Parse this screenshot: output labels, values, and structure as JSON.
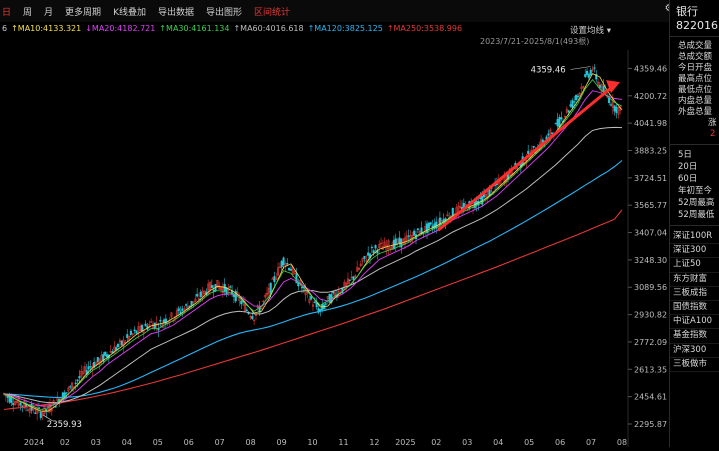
{
  "toolbar": {
    "items": [
      "日",
      "周",
      "月",
      "更多周期",
      "K线叠加",
      "导出数据",
      "导出图形",
      "区间统计"
    ],
    "active_index": 7
  },
  "ma_row": {
    "prefix": "6",
    "items": [
      {
        "label": "↑MA10:4133.321",
        "color": "#f5e04a"
      },
      {
        "label": "↓MA20:4182.721",
        "color": "#e040fb"
      },
      {
        "label": "↑MA30:4161.134",
        "color": "#39d353"
      },
      {
        "label": "↑MA60:4016.618",
        "color": "#bdbdbd"
      },
      {
        "label": "↑MA120:3825.125",
        "color": "#29b6f6"
      },
      {
        "label": "↑MA250:3538.996",
        "color": "#e53935"
      }
    ]
  },
  "settings_label": "设置均线",
  "range_label": "2023/7/21-2025/8/1(493根)",
  "chart_data": {
    "type": "line",
    "title": "",
    "y_ticks": [
      4359.46,
      4200.72,
      4041.98,
      3883.25,
      3724.51,
      3565.77,
      3407.04,
      3248.3,
      3089.56,
      2930.82,
      2772.09,
      2613.35,
      2454.61,
      2295.87
    ],
    "y_tick_labels": [
      "4359.46",
      "4200.72",
      "4041.98",
      "3883.25",
      "3724.51",
      "3565.77",
      "3407.04",
      "3248.30",
      "3089.56",
      "2930.82",
      "2772.09",
      "2613.35",
      "2454.61",
      "2295.87"
    ],
    "ylim": [
      2290,
      4420
    ],
    "x_tick_labels": [
      "2024",
      "02",
      "03",
      "04",
      "05",
      "06",
      "07",
      "08",
      "09",
      "10",
      "11",
      "12",
      "2025",
      "02",
      "03",
      "04",
      "05",
      "06",
      "07",
      "08"
    ],
    "max_label": "4359.46",
    "min_label": "2359.93",
    "price": [
      2470,
      2440,
      2420,
      2400,
      2380,
      2360,
      2380,
      2420,
      2460,
      2500,
      2550,
      2600,
      2640,
      2660,
      2700,
      2730,
      2760,
      2800,
      2830,
      2850,
      2880,
      2870,
      2900,
      2920,
      2950,
      2980,
      3010,
      3050,
      3090,
      3100,
      3080,
      3060,
      3020,
      2960,
      2920,
      2980,
      3060,
      3160,
      3250,
      3200,
      3120,
      3060,
      3000,
      2950,
      3010,
      3050,
      3080,
      3120,
      3180,
      3250,
      3300,
      3320,
      3330,
      3340,
      3350,
      3370,
      3400,
      3420,
      3440,
      3460,
      3490,
      3520,
      3540,
      3560,
      3580,
      3600,
      3640,
      3680,
      3720,
      3760,
      3800,
      3840,
      3880,
      3920,
      3960,
      4020,
      4080,
      4140,
      4200,
      4300,
      4359,
      4260,
      4200,
      4140,
      4100
    ],
    "ma20": [
      2470,
      2460,
      2445,
      2430,
      2415,
      2400,
      2400,
      2410,
      2430,
      2460,
      2490,
      2530,
      2570,
      2600,
      2640,
      2670,
      2700,
      2730,
      2760,
      2790,
      2820,
      2830,
      2850,
      2870,
      2900,
      2930,
      2960,
      2990,
      3020,
      3040,
      3050,
      3050,
      3040,
      3010,
      2980,
      2980,
      3010,
      3060,
      3120,
      3140,
      3120,
      3090,
      3060,
      3020,
      3010,
      3030,
      3050,
      3080,
      3120,
      3170,
      3210,
      3250,
      3270,
      3290,
      3310,
      3330,
      3360,
      3380,
      3400,
      3420,
      3450,
      3480,
      3500,
      3520,
      3540,
      3560,
      3590,
      3620,
      3660,
      3700,
      3740,
      3780,
      3820,
      3860,
      3900,
      3950,
      4000,
      4050,
      4110,
      4180,
      4230,
      4220,
      4200,
      4185,
      4180
    ],
    "ma60": [
      2470,
      2465,
      2455,
      2445,
      2435,
      2425,
      2420,
      2420,
      2425,
      2435,
      2450,
      2470,
      2495,
      2520,
      2550,
      2580,
      2610,
      2640,
      2670,
      2700,
      2730,
      2750,
      2770,
      2790,
      2810,
      2830,
      2850,
      2875,
      2900,
      2920,
      2935,
      2945,
      2950,
      2945,
      2935,
      2935,
      2950,
      2980,
      3020,
      3050,
      3065,
      3070,
      3070,
      3060,
      3060,
      3070,
      3085,
      3100,
      3120,
      3145,
      3170,
      3195,
      3215,
      3235,
      3255,
      3275,
      3300,
      3320,
      3340,
      3360,
      3385,
      3410,
      3430,
      3450,
      3470,
      3490,
      3515,
      3540,
      3570,
      3600,
      3630,
      3660,
      3695,
      3730,
      3765,
      3800,
      3840,
      3880,
      3920,
      3965,
      4000,
      4010,
      4015,
      4017,
      4016
    ],
    "ma120": [
      2470,
      2468,
      2465,
      2462,
      2458,
      2455,
      2452,
      2450,
      2450,
      2452,
      2456,
      2462,
      2470,
      2480,
      2492,
      2505,
      2520,
      2537,
      2555,
      2575,
      2595,
      2615,
      2635,
      2655,
      2675,
      2695,
      2715,
      2735,
      2755,
      2775,
      2792,
      2808,
      2822,
      2833,
      2842,
      2850,
      2860,
      2873,
      2888,
      2903,
      2917,
      2930,
      2941,
      2950,
      2960,
      2970,
      2982,
      2995,
      3010,
      3025,
      3042,
      3060,
      3078,
      3096,
      3114,
      3132,
      3150,
      3170,
      3190,
      3210,
      3230,
      3252,
      3273,
      3294,
      3315,
      3336,
      3357,
      3380,
      3403,
      3427,
      3451,
      3475,
      3500,
      3525,
      3550,
      3576,
      3602,
      3628,
      3655,
      3682,
      3708,
      3735,
      3760,
      3790,
      3825
    ],
    "ma250": [
      2380,
      2385,
      2390,
      2395,
      2400,
      2405,
      2410,
      2416,
      2422,
      2429,
      2436,
      2444,
      2452,
      2461,
      2470,
      2480,
      2490,
      2500,
      2511,
      2522,
      2533,
      2545,
      2557,
      2569,
      2581,
      2594,
      2607,
      2620,
      2633,
      2646,
      2659,
      2672,
      2685,
      2698,
      2711,
      2724,
      2738,
      2752,
      2766,
      2780,
      2794,
      2808,
      2822,
      2836,
      2850,
      2864,
      2878,
      2893,
      2908,
      2923,
      2938,
      2953,
      2968,
      2984,
      3000,
      3016,
      3032,
      3048,
      3064,
      3080,
      3096,
      3112,
      3128,
      3144,
      3160,
      3176,
      3192,
      3208,
      3225,
      3242,
      3259,
      3276,
      3293,
      3310,
      3327,
      3344,
      3361,
      3378,
      3395,
      3413,
      3431,
      3449,
      3467,
      3485,
      3539
    ]
  },
  "right_panel": {
    "title": "银行",
    "code": "822016",
    "stats": [
      "总成交量",
      "总成交额",
      "今日开盘",
      "最高点位",
      "最低点位",
      "内盘总量",
      "外盘总量"
    ],
    "stat_extra": "涨",
    "stat_extra_value": "2",
    "periods": [
      "5日",
      "20日",
      "60日",
      "年初至今",
      "52周最高",
      "52周最低"
    ],
    "indices": [
      "深证100R",
      "深证300",
      "上证50",
      "东方财富",
      "三板成指",
      "国债指数",
      "中证A100",
      "基金指数",
      "沪深300",
      "三板做市"
    ]
  },
  "colors": {
    "up": "#e53935",
    "down": "#26c6da",
    "ma10": "#f5e04a",
    "ma20": "#e040fb",
    "ma30": "#39d353",
    "ma60": "#bdbdbd",
    "ma120": "#29b6f6",
    "ma250": "#e53935"
  }
}
